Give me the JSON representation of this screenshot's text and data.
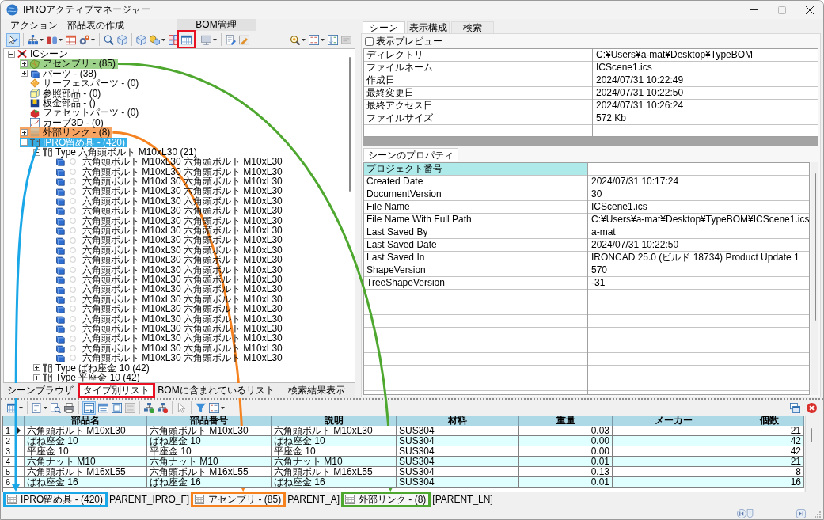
{
  "window": {
    "title": "IPROアクティブマネージャー"
  },
  "menus": [
    {
      "label": "アクション"
    },
    {
      "label": "部品表の作成"
    }
  ],
  "toolbar": {
    "group_title": "BOM管理",
    "select_tool_on": true,
    "bom_button_frame": {
      "color": "#e81123"
    }
  },
  "tree": {
    "label": "ICシーン",
    "kind": "scene",
    "expanded": true,
    "selected": false,
    "children": [
      {
        "label": "アセンブリ - (85)",
        "kind": "assembly",
        "expanded": false,
        "selected": false,
        "highlight": {
          "color": "#9dd28a",
          "arrow": {
            "color": "#4ea72e"
          }
        }
      },
      {
        "label": "パーツ - (38)",
        "kind": "part",
        "expanded": false,
        "selected": false
      },
      {
        "label": "サーフェスパーツ - (0)",
        "kind": "surface",
        "selected": false
      },
      {
        "label": "参照部品 - (0)",
        "kind": "reference",
        "selected": false
      },
      {
        "label": "板金部品 - ()",
        "kind": "sheet_metal",
        "selected": false
      },
      {
        "label": "ファセットパーツ - (0)",
        "kind": "facet",
        "selected": false
      },
      {
        "label": "カーブ3D - (0)",
        "kind": "curve",
        "selected": false
      },
      {
        "label": "外部リンク - (8)",
        "kind": "link",
        "expanded": false,
        "selected": false,
        "highlight": {
          "color": "#f7a462",
          "arrow": {
            "color": "#f5821f"
          }
        }
      },
      {
        "label": "IPRO留め具 - (420)",
        "kind": "fastener",
        "expanded": true,
        "selected": true,
        "highlight": {
          "color": "#35b0e8",
          "arrow": {
            "color": "#1aa7e8"
          }
        },
        "children": [
          {
            "label": "Type 六角頭ボルト M10xL30 (21)",
            "kind": "type",
            "expanded": true,
            "selected": false,
            "children": [
              {
                "label": "六角頭ボルト M10xL30 六角頭ボルト M10xL30",
                "kind": "instance",
                "selected": false
              },
              {
                "label": "六角頭ボルト M10xL30 六角頭ボルト M10xL30",
                "kind": "instance",
                "selected": false
              },
              {
                "label": "六角頭ボルト M10xL30 六角頭ボルト M10xL30",
                "kind": "instance",
                "selected": false
              },
              {
                "label": "六角頭ボルト M10xL30 六角頭ボルト M10xL30",
                "kind": "instance",
                "selected": false
              },
              {
                "label": "六角頭ボルト M10xL30 六角頭ボルト M10xL30",
                "kind": "instance",
                "selected": false
              },
              {
                "label": "六角頭ボルト M10xL30 六角頭ボルト M10xL30",
                "kind": "instance",
                "selected": false
              },
              {
                "label": "六角頭ボルト M10xL30 六角頭ボルト M10xL30",
                "kind": "instance",
                "selected": false
              },
              {
                "label": "六角頭ボルト M10xL30 六角頭ボルト M10xL30",
                "kind": "instance",
                "selected": false
              },
              {
                "label": "六角頭ボルト M10xL30 六角頭ボルト M10xL30",
                "kind": "instance",
                "selected": false
              },
              {
                "label": "六角頭ボルト M10xL30 六角頭ボルト M10xL30",
                "kind": "instance",
                "selected": false
              },
              {
                "label": "六角頭ボルト M10xL30 六角頭ボルト M10xL30",
                "kind": "instance",
                "selected": false
              },
              {
                "label": "六角頭ボルト M10xL30 六角頭ボルト M10xL30",
                "kind": "instance",
                "selected": false
              },
              {
                "label": "六角頭ボルト M10xL30 六角頭ボルト M10xL30",
                "kind": "instance",
                "selected": false
              },
              {
                "label": "六角頭ボルト M10xL30 六角頭ボルト M10xL30",
                "kind": "instance",
                "selected": false
              },
              {
                "label": "六角頭ボルト M10xL30 六角頭ボルト M10xL30",
                "kind": "instance",
                "selected": false
              },
              {
                "label": "六角頭ボルト M10xL30 六角頭ボルト M10xL30",
                "kind": "instance",
                "selected": false
              },
              {
                "label": "六角頭ボルト M10xL30 六角頭ボルト M10xL30",
                "kind": "instance",
                "selected": false
              },
              {
                "label": "六角頭ボルト M10xL30 六角頭ボルト M10xL30",
                "kind": "instance",
                "selected": false
              },
              {
                "label": "六角頭ボルト M10xL30 六角頭ボルト M10xL30",
                "kind": "instance",
                "selected": false
              },
              {
                "label": "六角頭ボルト M10xL30 六角頭ボルト M10xL30",
                "kind": "instance",
                "selected": false
              },
              {
                "label": "六角頭ボルト M10xL30 六角頭ボルト M10xL30",
                "kind": "instance",
                "selected": false
              }
            ]
          },
          {
            "label": "Type ばね座金 10 (42)",
            "kind": "type",
            "expanded": false,
            "selected": false
          },
          {
            "label": "Type 平座金 10 (42)",
            "kind": "type",
            "expanded": false,
            "selected": false
          }
        ]
      }
    ]
  },
  "left_tabs": [
    {
      "label": "シーンブラウザ",
      "selected": false
    },
    {
      "label": "タイプ別リスト",
      "selected": true,
      "frame": {
        "color": "#e81123"
      }
    },
    {
      "label": "BOMに含まれているリスト",
      "selected": false
    },
    {
      "label": "検索結果表示",
      "selected": false
    }
  ],
  "right_panel": {
    "tabs": [
      {
        "label": "シーン",
        "selected": true
      },
      {
        "label": "表示構成",
        "selected": false
      },
      {
        "label": "検索",
        "selected": false
      }
    ],
    "preview": {
      "label": "表示プレビュー",
      "checked": false
    },
    "file_info": [
      {
        "name": "ディレクトリ",
        "value": "C:¥Users¥a-mat¥Desktop¥TypeBOM"
      },
      {
        "name": "ファイルネーム",
        "value": "ICScene1.ics"
      },
      {
        "name": "作成日",
        "value": "2024/07/31 10:22:49"
      },
      {
        "name": "最終変更日",
        "value": "2024/07/31 10:22:50"
      },
      {
        "name": "最終アクセス日",
        "value": "2024/07/31 10:26:24"
      },
      {
        "name": "ファイルサイズ",
        "value": "572 Kb"
      }
    ],
    "properties_tab": "シーンのプロパティ",
    "properties": [
      {
        "name": "プロジェクト番号",
        "selected": true
      },
      {
        "name": "Created Date",
        "value": "2024/07/31 10:17:24",
        "selected": false
      },
      {
        "name": "DocumentVersion",
        "value": "30",
        "selected": false
      },
      {
        "name": "File Name",
        "value": "ICScene1.ics",
        "selected": false
      },
      {
        "name": "File Name With Full Path",
        "value": "C:¥Users¥a-mat¥Desktop¥TypeBOM¥ICScene1.ics",
        "selected": false
      },
      {
        "name": "Last Saved By",
        "value": "a-mat",
        "selected": false
      },
      {
        "name": "Last Saved Date",
        "value": "2024/07/31 10:22:50",
        "selected": false
      },
      {
        "name": "Last Saved In",
        "value": "IRONCAD 25.0 (ビルド 18734) Product Update 1",
        "selected": false
      },
      {
        "name": "ShapeVersion",
        "value": "570",
        "selected": false
      },
      {
        "name": "TreeShapeVersion",
        "value": "-31",
        "selected": false
      }
    ]
  },
  "bom_toolbar": {
    "list_view_on": true
  },
  "bom_table": {
    "columns": [
      "部品名",
      "部品番号",
      "説明",
      "材料",
      "重量",
      "メーカー",
      "個数"
    ],
    "rows": [
      {
        "number": "1",
        "selected": true,
        "part_name": "六角頭ボルト M10xL30",
        "part_number": "六角頭ボルト M10xL30",
        "description": "六角頭ボルト M10xL30",
        "material": "SUS304",
        "weight": "0.03",
        "quantity": "21"
      },
      {
        "number": "2",
        "selected": false,
        "part_name": "ばね座金 10",
        "part_number": "ばね座金 10",
        "description": "ばね座金 10",
        "material": "SUS304",
        "weight": "0.00",
        "quantity": "42"
      },
      {
        "number": "3",
        "selected": false,
        "part_name": "平座金 10",
        "part_number": "平座金 10",
        "description": "平座金 10",
        "material": "SUS304",
        "weight": "0.00",
        "quantity": "42"
      },
      {
        "number": "4",
        "selected": false,
        "part_name": "六角ナット M10",
        "part_number": "六角ナット M10",
        "description": "六角ナット M10",
        "material": "SUS304",
        "weight": "0.01",
        "quantity": "21"
      },
      {
        "number": "5",
        "selected": false,
        "part_name": "六角頭ボルト M16xL55",
        "part_number": "六角頭ボルト M16xL55",
        "description": "六角頭ボルト M16xL55",
        "material": "SUS304",
        "weight": "0.13",
        "quantity": "8"
      },
      {
        "number": "6",
        "selected": false,
        "part_name": "ばね座金 16",
        "part_number": "ばね座金 16",
        "description": "ばね座金 16",
        "material": "SUS304",
        "weight": "0.01",
        "quantity": "16"
      }
    ]
  },
  "sheet_tabs": [
    {
      "label": "IPRO留め具 - (420)",
      "note": "PARENT_IPRO_F]",
      "frame": {
        "color": "#1aa7e8"
      }
    },
    {
      "label": "アセンブリ - (85)",
      "note": "PARENT_A]",
      "frame": {
        "color": "#f5821f"
      }
    },
    {
      "label": "外部リンク - (8)",
      "note": "[PARENT_LN]",
      "frame": {
        "color": "#4ea72e"
      }
    }
  ]
}
